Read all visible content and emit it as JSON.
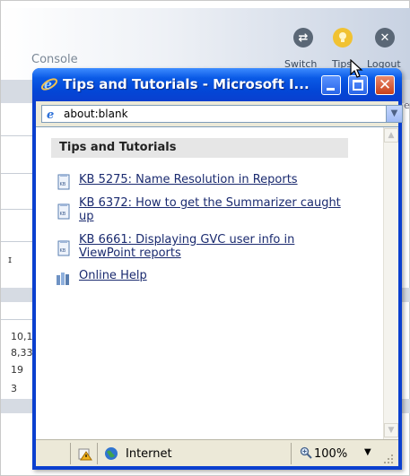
{
  "background_app": {
    "section_title": "Console",
    "header_actions": [
      {
        "label": "Switch",
        "icon": "switch-icon"
      },
      {
        "label": "Tips",
        "icon": "lightbulb-icon"
      },
      {
        "label": "Logout",
        "icon": "close-circle-icon"
      }
    ],
    "row_fragment": "ɪ",
    "numbers": [
      "10,1",
      "8,33",
      "19",
      "3"
    ],
    "fragment_edge": "e"
  },
  "popup": {
    "title": "Tips and Tutorials - Microsoft I...",
    "address": "about:blank",
    "heading": "Tips and Tutorials",
    "items": [
      {
        "label": "KB 5275: Name Resolution in Reports",
        "icon": "kb-document-icon"
      },
      {
        "label": "KB 6372: How to get the Summarizer caught up",
        "icon": "kb-document-icon"
      },
      {
        "label": "KB 6661: Displaying GVC user info in ViewPoint reports",
        "icon": "kb-document-icon"
      },
      {
        "label": "Online Help",
        "icon": "help-book-icon"
      }
    ],
    "status": {
      "zone": "Internet",
      "zoom": "100%"
    }
  },
  "colors": {
    "title_bar": "#0a5ae6",
    "link": "#1a2a6f",
    "heading_band": "#e6e6e6"
  }
}
